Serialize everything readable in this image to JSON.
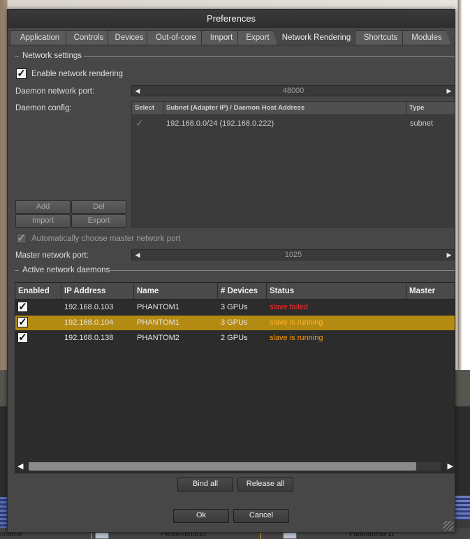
{
  "dialog": {
    "title": "Preferences"
  },
  "tabs": [
    {
      "label": "Application"
    },
    {
      "label": "Controls"
    },
    {
      "label": "Devices"
    },
    {
      "label": "Out-of-core"
    },
    {
      "label": "Import"
    },
    {
      "label": "Export"
    },
    {
      "label": "Network Rendering",
      "active": true
    },
    {
      "label": "Shortcuts"
    },
    {
      "label": "Modules"
    }
  ],
  "network_settings": {
    "section_title": "Network settings",
    "enable_label": "Enable network rendering",
    "enable_checked": true,
    "daemon_port_label": "Daemon network port:",
    "daemon_port_value": "48000",
    "daemon_config_label": "Daemon config:",
    "config_table": {
      "headers": [
        "Select",
        "Subnet (Adapter IP) / Daemon Host Address",
        "Type"
      ],
      "rows": [
        {
          "selected": true,
          "address": "192.168.0.0/24 (192.168.0.222)",
          "type": "subnet"
        }
      ]
    },
    "buttons": {
      "add": "Add",
      "del": "Del",
      "import": "Import",
      "export": "Export"
    },
    "auto_master_label": "Automatically choose master network port",
    "auto_master_checked": true,
    "master_port_label": "Master network port:",
    "master_port_value": "1025"
  },
  "active_daemons": {
    "section_title": "Active network daemons",
    "headers": [
      "Enabled",
      "IP Address",
      "Name",
      "# Devices",
      "Status",
      "Master"
    ],
    "rows": [
      {
        "enabled": true,
        "ip": "192.168.0.103",
        "name": "PHANTOM1",
        "devices": "3 GPUs",
        "status": "slave failed",
        "status_kind": "failed",
        "selected": false
      },
      {
        "enabled": true,
        "ip": "192.168.0.104",
        "name": "PHANTOM1",
        "devices": "3 GPUs",
        "status": "slave is running",
        "status_kind": "running",
        "selected": true
      },
      {
        "enabled": true,
        "ip": "192.168.0.138",
        "name": "PHANTOM2",
        "devices": "2 GPUs",
        "status": "slave is running",
        "status_kind": "running",
        "selected": false
      }
    ],
    "bind_all": "Bind all",
    "release_all": "Release all"
  },
  "footer": {
    "ok": "Ok",
    "cancel": "Cancel"
  },
  "taskbar": {
    "items": [
      "erior09",
      "PanoInterior10",
      "PanoInterior11"
    ]
  },
  "colors": {
    "selected_row": "#b38a12",
    "status_failed": "#ff2a2a",
    "status_running": "#ff9a00"
  }
}
